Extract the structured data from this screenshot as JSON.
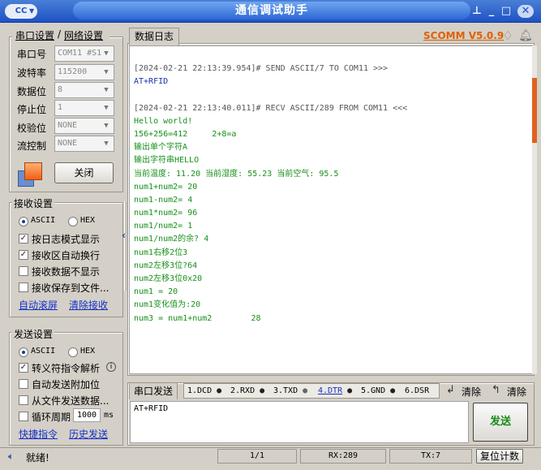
{
  "window": {
    "title": "通信调试助手",
    "logo": "CC"
  },
  "header": {
    "version": "SCOMM V5.0.9"
  },
  "tabs": {
    "serial": "串口设置",
    "network": "网络设置"
  },
  "serial": {
    "port_label": "串口号",
    "port_value": "COM11 #S1",
    "baud_label": "波特率",
    "baud_value": "115200",
    "databits_label": "数据位",
    "databits_value": "8",
    "stopbits_label": "停止位",
    "stopbits_value": "1",
    "parity_label": "校验位",
    "parity_value": "NONE",
    "flow_label": "流控制",
    "flow_value": "NONE",
    "close_button": "关闭"
  },
  "receive": {
    "title": "接收设置",
    "ascii": "ASCII",
    "hex": "HEX",
    "opt_log": "按日志模式显示",
    "opt_wrap": "接收区自动换行",
    "opt_hide": "接收数据不显示",
    "opt_save": "接收保存到文件...",
    "link_scroll": "自动滚屏",
    "link_clear": "清除接收"
  },
  "send": {
    "title": "发送设置",
    "ascii": "ASCII",
    "hex": "HEX",
    "opt_escape": "转义符指令解析",
    "opt_append": "自动发送附加位",
    "opt_file": "从文件发送数据...",
    "opt_cycle": "循环周期",
    "cycle_value": "1000",
    "cycle_unit": "ms",
    "link_quick": "快捷指令",
    "link_history": "历史发送"
  },
  "log_tab": "数据日志",
  "log_lines": [
    {
      "t": "[2024-02-21 22:13:39.954]# SEND ASCII/7 TO COM11 >>>",
      "c": "hdr"
    },
    {
      "t": "AT+RFID",
      "c": "sent"
    },
    {
      "t": "",
      "c": "hdr"
    },
    {
      "t": "[2024-02-21 22:13:40.011]# RECV ASCII/289 FROM COM11 <<<",
      "c": "hdr"
    },
    {
      "t": "Hello world!",
      "c": "recv"
    },
    {
      "t": "156+256=412     2+8=a",
      "c": "recv"
    },
    {
      "t": "输出单个字符A",
      "c": "recv"
    },
    {
      "t": "输出字符串HELLO",
      "c": "recv"
    },
    {
      "t": "当前温度: 11.20 当前湿度: 55.23 当前空气: 95.5",
      "c": "recv"
    },
    {
      "t": "num1+num2= 20",
      "c": "recv"
    },
    {
      "t": "num1-num2= 4",
      "c": "recv"
    },
    {
      "t": "num1*num2= 96",
      "c": "recv"
    },
    {
      "t": "num1/num2= 1",
      "c": "recv"
    },
    {
      "t": "num1/num2的余? 4",
      "c": "recv"
    },
    {
      "t": "num1右移2位3",
      "c": "recv"
    },
    {
      "t": "num2左移3位?64",
      "c": "recv"
    },
    {
      "t": "num2左移3位0x20",
      "c": "recv"
    },
    {
      "t": "num1 = 20",
      "c": "recv"
    },
    {
      "t": "num1变化值为:20",
      "c": "recv"
    },
    {
      "t": "num3 = num1+num2        28",
      "c": "recv"
    }
  ],
  "sendbar": {
    "tab": "串口发送",
    "dcd": "1.DCD",
    "rxd": "2.RXD",
    "txd": "3.TXD",
    "dtr": "4.DTR",
    "gnd": "5.GND",
    "dsr": "6.DSR",
    "clear1": "清除",
    "clear2": "清除",
    "input": "AT+RFID",
    "send_button": "发送"
  },
  "status": {
    "ready": "就绪!",
    "page": "1/1",
    "rx": "RX:289",
    "tx": "TX:7",
    "reset": "复位计数"
  }
}
